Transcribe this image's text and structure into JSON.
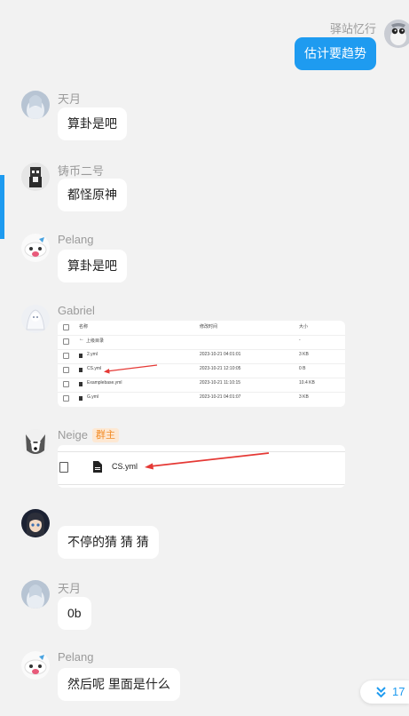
{
  "messages": [
    {
      "sender": "驿站忆行",
      "text": "估计要趋势"
    },
    {
      "sender": "天月",
      "text": "算卦是吧"
    },
    {
      "sender": "铸币二号",
      "text": "都怪原神"
    },
    {
      "sender": "Pelang",
      "text": "算卦是吧"
    },
    {
      "sender": "Gabriel"
    },
    {
      "sender": "Neige",
      "badge": "群主"
    },
    {
      "sender": "",
      "text": "不停的猜 猜 猜"
    },
    {
      "sender": "天月",
      "text": "0b"
    },
    {
      "sender": "Pelang",
      "text": "然后呢 里面是什么"
    }
  ],
  "file_table": {
    "headers": [
      "名称",
      "修改时间",
      "大小"
    ],
    "rows": [
      {
        "name": "上级目录",
        "time": "",
        "size": "-"
      },
      {
        "name": "2.yml",
        "time": "2023-10-21 04:01:01",
        "size": "3 KB"
      },
      {
        "name": "CS.yml",
        "time": "2023-10-21 12:10:05",
        "size": "0 B"
      },
      {
        "name": "Examplebase.yml",
        "time": "2023-10-21 11:10:15",
        "size": "10.4 KB"
      },
      {
        "name": "G.yml",
        "time": "2023-10-21 04:01:07",
        "size": "3 KB"
      }
    ]
  },
  "crop_file": {
    "name": "CS.yml"
  },
  "scroll_button": {
    "count": "17"
  },
  "colors": {
    "accent": "#1e9bf0",
    "bubble": "#ffffff",
    "background": "#f2f2f2",
    "arrow": "#e53935",
    "badge_text": "#f28b25",
    "badge_bg": "#fde8d3"
  },
  "icons": [
    "double-chevron-down-icon",
    "back-arrow-icon",
    "file-icon"
  ]
}
